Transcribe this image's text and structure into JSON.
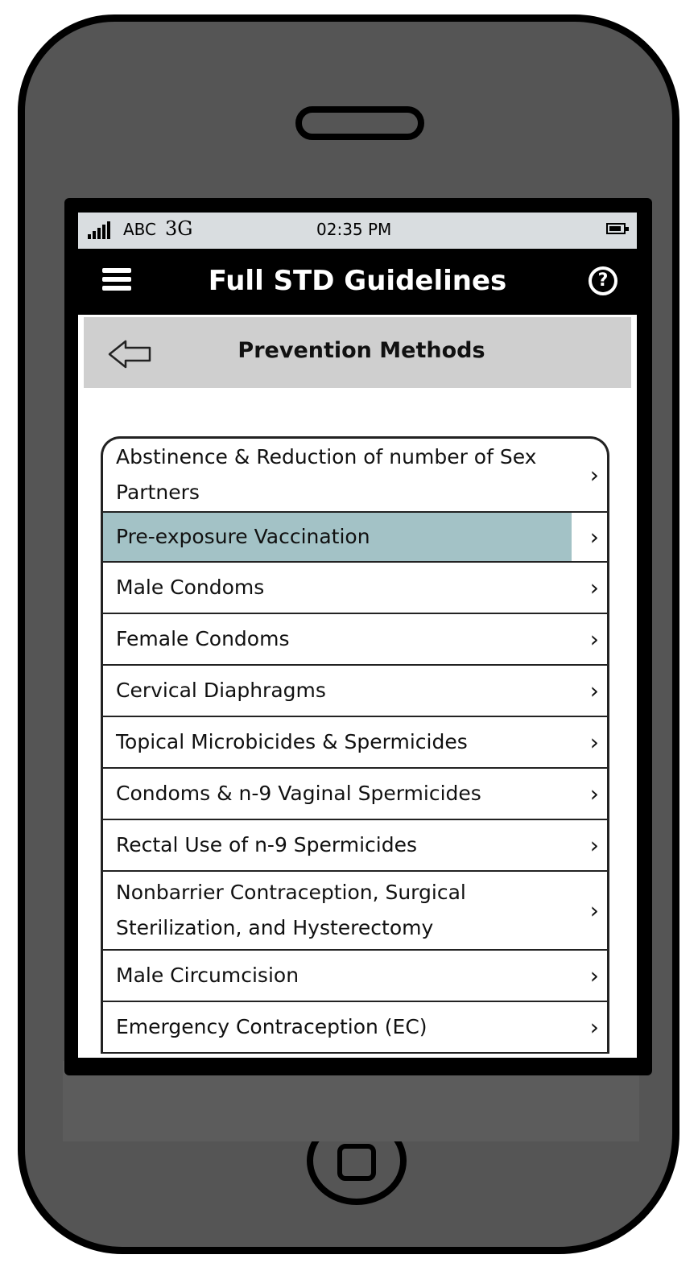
{
  "status_bar": {
    "carrier": "ABC",
    "network": "3G",
    "time": "02:35 PM"
  },
  "nav_bar": {
    "title": "Full STD Guidelines",
    "menu_icon": "hamburger-menu-icon",
    "help_icon": "help-icon",
    "help_glyph": "?"
  },
  "sub_header": {
    "title": "Prevention Methods",
    "back_icon": "back-arrow-icon"
  },
  "list": {
    "selected_index": 1,
    "chevron": "›",
    "items": [
      {
        "label": "Abstinence & Reduction of number of Sex Partners"
      },
      {
        "label": "Pre-exposure Vaccination"
      },
      {
        "label": "Male Condoms"
      },
      {
        "label": "Female Condoms"
      },
      {
        "label": "Cervical Diaphragms"
      },
      {
        "label": "Topical Microbicides & Spermicides"
      },
      {
        "label": "Condoms & n-9 Vaginal Spermicides"
      },
      {
        "label": "Rectal Use of n-9 Spermicides"
      },
      {
        "label": "Nonbarrier Contraception, Surgical Sterilization, and Hysterectomy"
      },
      {
        "label": "Male Circumcision"
      },
      {
        "label": "Emergency Contraception (EC)"
      }
    ]
  },
  "colors": {
    "device_body": "#555555",
    "status_bar_bg": "#d9dde0",
    "nav_bar_bg": "#000000",
    "sub_header_bg": "#cfcfcf",
    "selected_row_bg": "#a3c2c6"
  }
}
